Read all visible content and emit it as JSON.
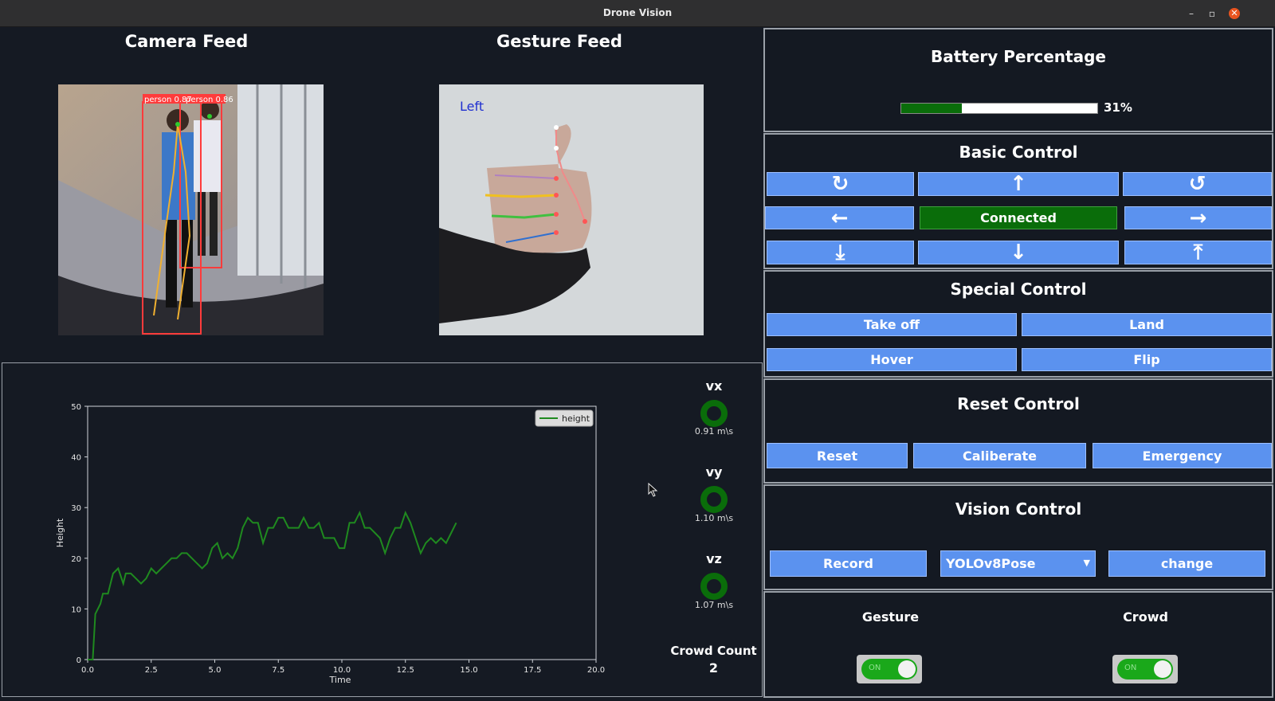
{
  "window": {
    "title": "Drone Vision"
  },
  "feeds": {
    "camera_title": "Camera Feed",
    "gesture_title": "Gesture Feed",
    "camera_labels": [
      "person 0.87",
      "person 0.86"
    ],
    "gesture_label": "Left"
  },
  "battery": {
    "title": "Battery Percentage",
    "percent": 31,
    "percent_text": "31%"
  },
  "basic_control": {
    "title": "Basic Control",
    "status": "Connected"
  },
  "special_control": {
    "title": "Special Control",
    "takeoff": "Take off",
    "land": "Land",
    "hover": "Hover",
    "flip": "Flip"
  },
  "reset_control": {
    "title": "Reset Control",
    "reset": "Reset",
    "calibrate": "Caliberate",
    "emergency": "Emergency"
  },
  "vision_control": {
    "title": "Vision Control",
    "record": "Record",
    "model": "YOLOv8Pose",
    "change": "change"
  },
  "toggles": {
    "gesture_label": "Gesture",
    "crowd_label": "Crowd",
    "gesture_state": "ON",
    "crowd_state": "ON"
  },
  "gauges": [
    {
      "label": "vx",
      "value": "0.91 m\\s"
    },
    {
      "label": "vy",
      "value": "1.10 m\\s"
    },
    {
      "label": "vz",
      "value": "1.07 m\\s"
    }
  ],
  "crowd": {
    "label": "Crowd Count",
    "value": "2"
  },
  "colors": {
    "accent": "#5b92ef",
    "connected": "#0a6d0a",
    "series": "#1f8a1f"
  },
  "chart_data": {
    "type": "line",
    "xlabel": "Time",
    "ylabel": "Height",
    "xlim": [
      0,
      20
    ],
    "ylim": [
      0,
      50
    ],
    "xticks": [
      "0.0",
      "2.5",
      "5.0",
      "7.5",
      "10.0",
      "12.5",
      "15.0",
      "17.5",
      "20.0"
    ],
    "yticks": [
      "0",
      "10",
      "20",
      "30",
      "40",
      "50"
    ],
    "legend": "top-right",
    "series": [
      {
        "name": "height",
        "x": [
          0.0,
          0.2,
          0.3,
          0.5,
          0.6,
          0.8,
          1.0,
          1.2,
          1.4,
          1.5,
          1.7,
          1.9,
          2.1,
          2.3,
          2.5,
          2.7,
          2.9,
          3.1,
          3.3,
          3.5,
          3.7,
          3.9,
          4.1,
          4.3,
          4.5,
          4.7,
          4.9,
          5.1,
          5.3,
          5.5,
          5.7,
          5.9,
          6.1,
          6.3,
          6.5,
          6.7,
          6.9,
          7.1,
          7.3,
          7.5,
          7.7,
          7.9,
          8.1,
          8.3,
          8.5,
          8.7,
          8.9,
          9.1,
          9.3,
          9.5,
          9.7,
          9.9,
          10.1,
          10.3,
          10.5,
          10.7,
          10.9,
          11.1,
          11.3,
          11.5,
          11.7,
          11.9,
          12.1,
          12.3,
          12.5,
          12.7,
          12.9,
          13.1,
          13.3,
          13.5,
          13.7,
          13.9,
          14.1,
          14.3,
          14.5
        ],
        "y": [
          0,
          0,
          9,
          11,
          13,
          13,
          17,
          18,
          15,
          17,
          17,
          16,
          15,
          16,
          18,
          17,
          18,
          19,
          20,
          20,
          21,
          21,
          20,
          19,
          18,
          19,
          22,
          23,
          20,
          21,
          20,
          22,
          26,
          28,
          27,
          27,
          23,
          26,
          26,
          28,
          28,
          26,
          26,
          26,
          28,
          26,
          26,
          27,
          24,
          24,
          24,
          22,
          22,
          27,
          27,
          29,
          26,
          26,
          25,
          24,
          21,
          24,
          26,
          26,
          29,
          27,
          24,
          21,
          23,
          24,
          23,
          24,
          23,
          25,
          27
        ]
      }
    ]
  }
}
